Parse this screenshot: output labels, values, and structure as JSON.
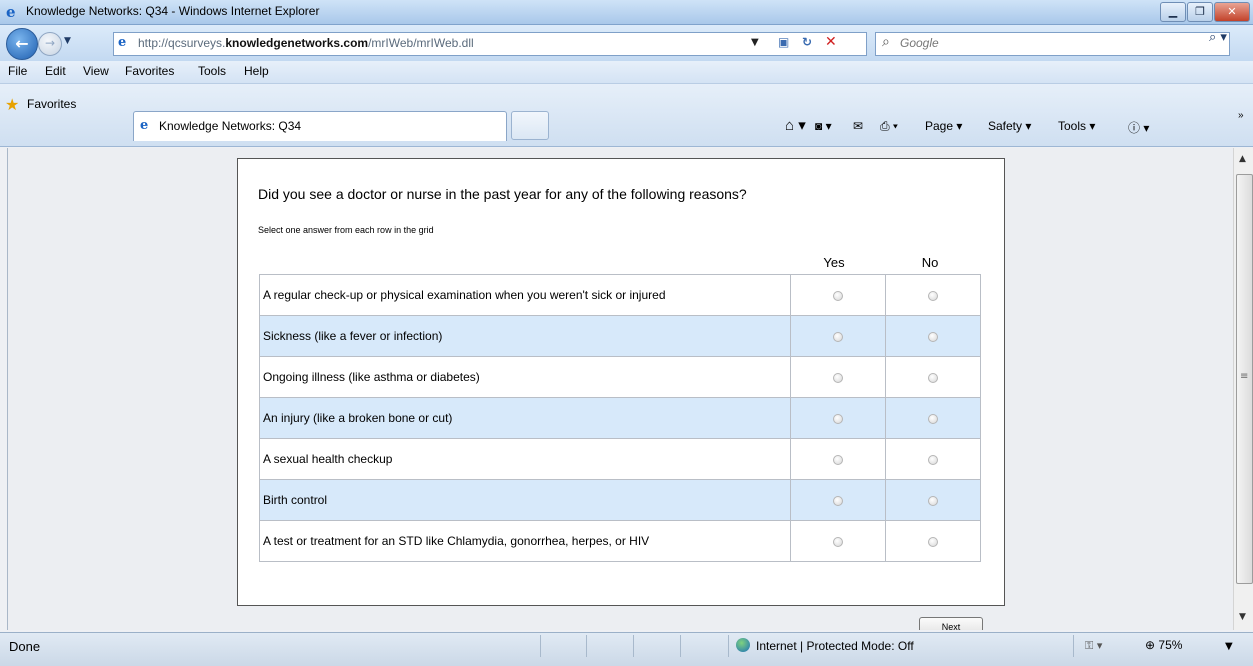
{
  "window": {
    "title": "Knowledge Networks: Q34 - Windows Internet Explorer",
    "controls": {
      "minimize": "▁",
      "restore": "❐",
      "close": "✕"
    }
  },
  "address": {
    "url_prefix": "http://qcsurveys.",
    "url_domain": "knowledgenetworks.com",
    "url_path": "/mrIWeb/mrIWeb.dll",
    "search_placeholder": "Google"
  },
  "menu": [
    "File",
    "Edit",
    "View",
    "Favorites",
    "Tools",
    "Help"
  ],
  "favorites_bar": {
    "favorites_label": "Favorites",
    "tab_title": "Knowledge Networks: Q34",
    "commands": [
      "Page ▾",
      "Safety ▾",
      "Tools ▾"
    ]
  },
  "survey": {
    "question": "Did you see a doctor or nurse in the past year for any of the following reasons?",
    "instruction": "Select one answer from each row in the grid",
    "columns": [
      "Yes",
      "No"
    ],
    "rows": [
      "A regular check-up or physical examination when you weren't sick or injured",
      "Sickness (like a fever or infection)",
      "Ongoing illness (like asthma or diabetes)",
      "An injury (like a broken bone or cut)",
      "A sexual health checkup",
      "Birth control",
      "A test or treatment for an STD like Chlamydia, gonorrhea, herpes, or HIV"
    ],
    "next_label": "Next"
  },
  "status": {
    "text": "Done",
    "zone": "Internet | Protected Mode: Off",
    "zoom": "75%"
  },
  "colors": {
    "alt_row": "#d7e9fa",
    "border": "#b9bec6"
  }
}
